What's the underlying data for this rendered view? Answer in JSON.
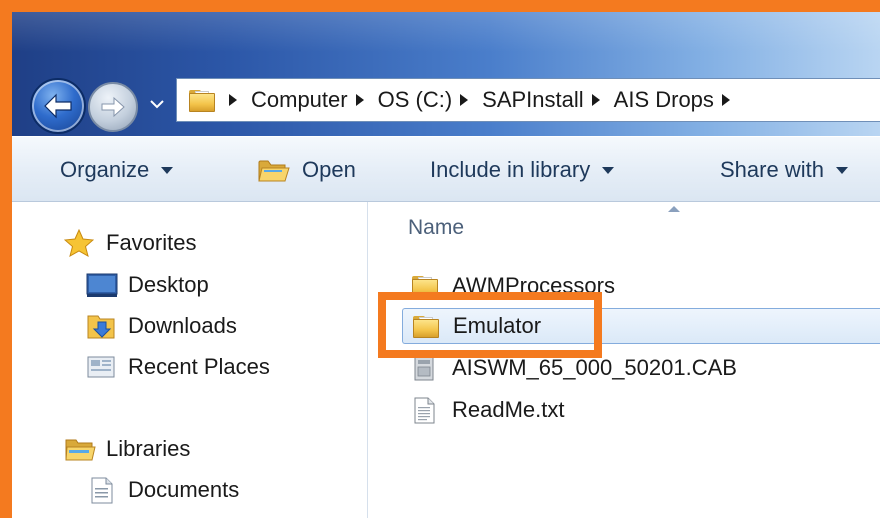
{
  "address": {
    "crumbs": [
      "Computer",
      "OS (C:)",
      "SAPInstall",
      "AIS Drops"
    ]
  },
  "toolbar": {
    "organize": "Organize",
    "open": "Open",
    "include": "Include in library",
    "share": "Share with"
  },
  "navpane": {
    "favorites": "Favorites",
    "desktop": "Desktop",
    "downloads": "Downloads",
    "recent": "Recent Places",
    "libraries": "Libraries",
    "documents": "Documents"
  },
  "content": {
    "column_name": "Name",
    "files": [
      {
        "name": "AWMProcessors",
        "type": "folder"
      },
      {
        "name": "Emulator",
        "type": "folder",
        "selected": true
      },
      {
        "name": "AISWM_65_000_50201.CAB",
        "type": "cab"
      },
      {
        "name": "ReadMe.txt",
        "type": "txt"
      }
    ]
  },
  "colors": {
    "highlight": "#f47a1f",
    "selection": "#dbe9f8",
    "toolbar_text": "#1e395b"
  }
}
